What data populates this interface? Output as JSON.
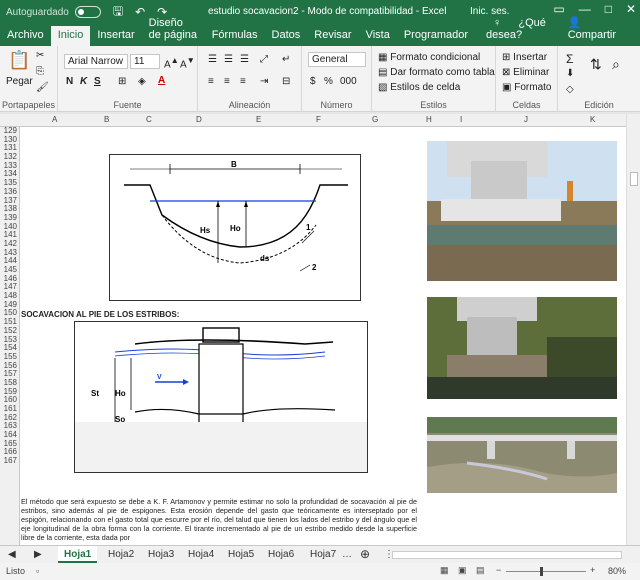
{
  "titlebar": {
    "autosave_label": "Autoguardado",
    "title": "estudio socavacion2  -  Modo de compatibilidad  -  Excel",
    "user": "Inic. ses."
  },
  "tabs": [
    "Archivo",
    "Inicio",
    "Insertar",
    "Diseño de página",
    "Fórmulas",
    "Datos",
    "Revisar",
    "Vista",
    "Programador"
  ],
  "active_tab": "Inicio",
  "help": "¿Qué desea?",
  "share": "Compartir",
  "ribbon": {
    "paste": "Pegar",
    "font_name": "Arial Narrow",
    "font_size": "11",
    "bold": "N",
    "italic": "K",
    "underline": "S",
    "number_format": "General",
    "cond_format": "Formato condicional",
    "table_format": "Dar formato como tabla",
    "cell_styles": "Estilos de celda",
    "insert": "Insertar",
    "delete": "Eliminar",
    "format": "Formato",
    "groups": [
      "Portapapeles",
      "Fuente",
      "Alineación",
      "Número",
      "Estilos",
      "Celdas",
      "Edición"
    ]
  },
  "columns": [
    "A",
    "B",
    "C",
    "D",
    "E",
    "F",
    "G",
    "H",
    "I",
    "J",
    "K"
  ],
  "rows": [
    "129",
    "130",
    "131",
    "132",
    "133",
    "134",
    "135",
    "136",
    "137",
    "138",
    "139",
    "140",
    "141",
    "142",
    "143",
    "144",
    "145",
    "146",
    "147",
    "148",
    "149",
    "150",
    "151",
    "152",
    "153",
    "154",
    "155",
    "156",
    "157",
    "158",
    "159",
    "160",
    "161",
    "162",
    "163",
    "164",
    "165",
    "166",
    "167"
  ],
  "diagram1": {
    "b": "B",
    "hs": "Hs",
    "ho": "Ho",
    "ds": "ds",
    "one": "1",
    "two": "2"
  },
  "caption": "SOCAVACION AL PIE DE LOS ESTRIBOS:",
  "diagram2": {
    "st": "St",
    "ho": "Ho",
    "so": "So",
    "v": "V"
  },
  "paragraph": "El  método que será expuesto se debe a K. F. Artamonov y permite estimar no solo la profundidad de socavación  al  pie  de estribos, sino además al pie de espigones. Esta erosión depende del gasto que teóricamente es interseptado por el espigón, relacionando  con  el gasto  total  que  escurre  por el río, del talud  que  tienen los lados del estribo y del ángulo  que  el  eje longitudinal de la obra  forma con la corriente. El tirante incrementado al pie de un estribo medido desde la superficie libre de la corriente, esta dada por",
  "sheets": [
    "Hoja1",
    "Hoja2",
    "Hoja3",
    "Hoja4",
    "Hoja5",
    "Hoja6",
    "Hoja7"
  ],
  "active_sheet": "Hoja1",
  "status": {
    "mode": "Listo",
    "zoom": "80%"
  },
  "colors": {
    "accent": "#217346",
    "ribbon": "#f3f3f3"
  }
}
